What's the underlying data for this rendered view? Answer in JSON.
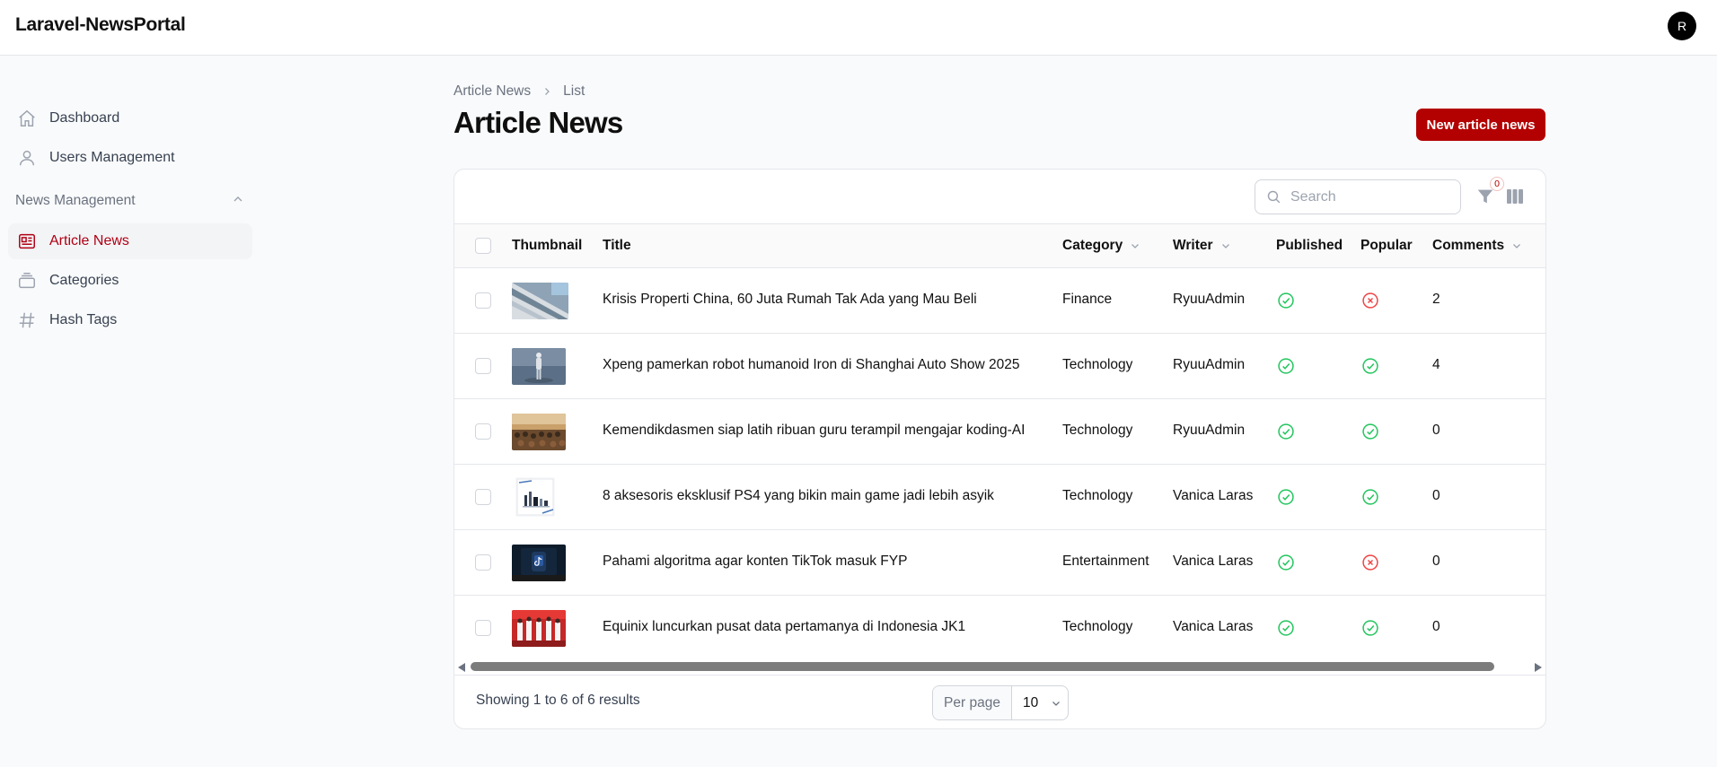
{
  "app": {
    "brand": "Laravel-NewsPortal",
    "avatar_initial": "R"
  },
  "sidebar": {
    "items": [
      {
        "label": "Dashboard",
        "icon": "home-icon"
      },
      {
        "label": "Users Management",
        "icon": "user-icon"
      }
    ],
    "group": {
      "label": "News Management",
      "items": [
        {
          "label": "Article News",
          "icon": "newspaper-icon",
          "active": true
        },
        {
          "label": "Categories",
          "icon": "stack-icon"
        },
        {
          "label": "Hash Tags",
          "icon": "hashtag-icon"
        }
      ]
    }
  },
  "breadcrumb": [
    "Article News",
    "List"
  ],
  "page": {
    "title": "Article News",
    "new_button": "New article news"
  },
  "toolbar": {
    "search_placeholder": "Search",
    "filter_count": "0"
  },
  "table": {
    "columns": [
      "Thumbnail",
      "Title",
      "Category",
      "Writer",
      "Published",
      "Popular",
      "Comments"
    ],
    "rows": [
      {
        "title": "Krisis Properti China, 60 Juta Rumah Tak Ada yang Mau Beli",
        "category": "Finance",
        "writer": "RyuuAdmin",
        "published": true,
        "popular": false,
        "comments": "2"
      },
      {
        "title": "Xpeng pamerkan robot humanoid Iron di Shanghai Auto Show 2025",
        "category": "Technology",
        "writer": "RyuuAdmin",
        "published": true,
        "popular": true,
        "comments": "4"
      },
      {
        "title": "Kemendikdasmen siap latih ribuan guru terampil mengajar koding-AI",
        "category": "Technology",
        "writer": "RyuuAdmin",
        "published": true,
        "popular": true,
        "comments": "0"
      },
      {
        "title": "8 aksesoris eksklusif PS4 yang bikin main game jadi lebih asyik",
        "category": "Technology",
        "writer": "Vanica Laras",
        "published": true,
        "popular": true,
        "comments": "0"
      },
      {
        "title": "Pahami algoritma agar konten TikTok masuk FYP",
        "category": "Entertainment",
        "writer": "Vanica Laras",
        "published": true,
        "popular": false,
        "comments": "0"
      },
      {
        "title": "Equinix luncurkan pusat data pertamanya di Indonesia JK1",
        "category": "Technology",
        "writer": "Vanica Laras",
        "published": true,
        "popular": true,
        "comments": "0"
      }
    ]
  },
  "pagination": {
    "summary": "Showing 1 to 6 of 6 results",
    "per_page_label": "Per page",
    "per_page_value": "10"
  },
  "colors": {
    "accent": "#b30000",
    "success": "#22c55e",
    "danger": "#ef4444"
  }
}
